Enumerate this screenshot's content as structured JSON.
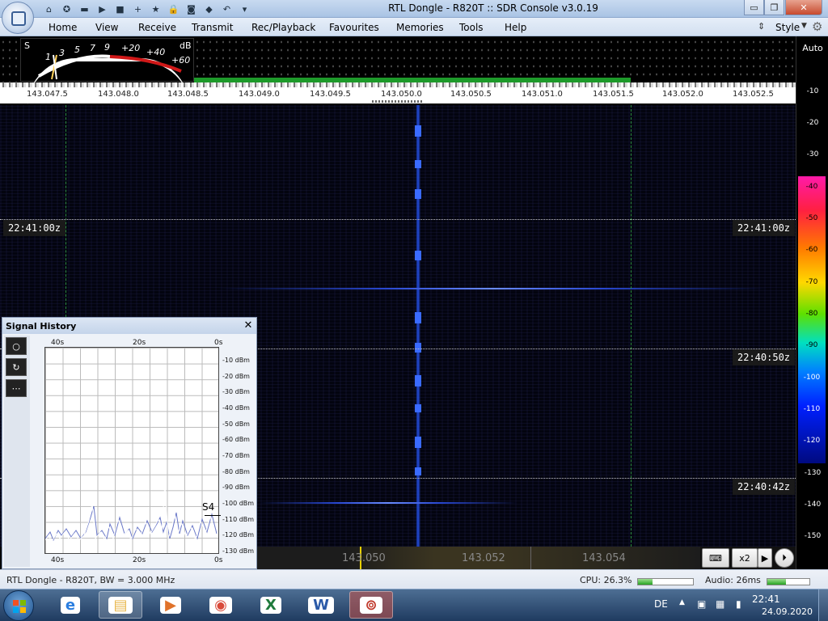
{
  "window": {
    "title": "RTL Dongle - R820T :: SDR Console v3.0.19",
    "min": "▭",
    "max": "❐",
    "close": "✕"
  },
  "quick_access": [
    {
      "icon": "home-icon",
      "glyph": "⌂"
    },
    {
      "icon": "lifebuoy-icon",
      "glyph": "✪"
    },
    {
      "icon": "folder-icon",
      "glyph": "▬"
    },
    {
      "icon": "play-icon",
      "glyph": "▶"
    },
    {
      "icon": "stop-icon",
      "glyph": "■"
    },
    {
      "icon": "add-icon",
      "glyph": "+"
    },
    {
      "icon": "star-icon",
      "glyph": "★"
    },
    {
      "icon": "lock-icon",
      "glyph": "🔒"
    },
    {
      "icon": "camera-icon",
      "glyph": "◙"
    },
    {
      "icon": "drop-icon",
      "glyph": "◆"
    },
    {
      "icon": "undo-icon",
      "glyph": "↶"
    },
    {
      "icon": "dropdown-icon",
      "glyph": "▾"
    }
  ],
  "menu": [
    "Home",
    "View",
    "Receive",
    "Transmit",
    "Rec/Playback",
    "Favourites",
    "Memories",
    "Tools",
    "Help"
  ],
  "style_label": "Style",
  "smeter": {
    "s": "S",
    "db": "dB",
    "labels": [
      "1",
      "3",
      "5",
      "7",
      "9",
      "+20",
      "+40",
      "+60"
    ]
  },
  "freq_labels": [
    "143.047.5",
    "143.048.0",
    "143.048.5",
    "143.049.0",
    "143.049.5",
    "143.050.0",
    "143.050.5",
    "143.051.0",
    "143.051.5",
    "143.052.0",
    "143.052.5"
  ],
  "time_labels": [
    "22:41:00z",
    "22:40:50z",
    "22:40:42z"
  ],
  "scale": {
    "auto": "Auto",
    "top": [
      "-10",
      "-20",
      "-30"
    ],
    "color": [
      "-40",
      "-50",
      "-60",
      "-70",
      "-80",
      "-90",
      "-100",
      "-110",
      "-120"
    ],
    "bottom": [
      "-130",
      "-140",
      "-150"
    ]
  },
  "signal_history": {
    "title": "Signal History",
    "close": "✕",
    "buttons": [
      "○",
      "↻",
      "⋯"
    ],
    "top_ticks": [
      "40s",
      "20s",
      "0s"
    ],
    "bottom_ticks": [
      "40s",
      "20s",
      "0s"
    ],
    "db_ticks": [
      "-10 dBm",
      "-20 dBm",
      "-30 dBm",
      "-40 dBm",
      "-50 dBm",
      "-60 dBm",
      "-70 dBm",
      "-80 dBm",
      "-90 dBm",
      "-100 dBm",
      "-110 dBm",
      "-120 dBm",
      "-130 dBm"
    ],
    "s_label": "S4"
  },
  "tuner": {
    "f1": "143.050",
    "f2": "143.052",
    "f3": "143.054",
    "zoom": "x2",
    "keyboard": "⌨",
    "arrow": "▶",
    "play": "⏵"
  },
  "status": {
    "device": "RTL Dongle - R820T, BW = 3.000 MHz",
    "cpu": "CPU: 26.3%",
    "audio": "Audio: 26ms",
    "cpu_level": 0.26,
    "audio_level": 0.45
  },
  "taskbar": {
    "apps": [
      {
        "icon": "internet-explorer-icon",
        "glyph": "e",
        "color": "#2a7ee0"
      },
      {
        "icon": "file-explorer-icon",
        "glyph": "▤",
        "color": "#e8b64a"
      },
      {
        "icon": "media-player-icon",
        "glyph": "▶",
        "color": "#e0722a"
      },
      {
        "icon": "chrome-icon",
        "glyph": "◉",
        "color": "#d94a3a"
      },
      {
        "icon": "excel-icon",
        "glyph": "X",
        "color": "#1f7a3c"
      },
      {
        "icon": "word-icon",
        "glyph": "W",
        "color": "#2b5aa8"
      },
      {
        "icon": "sdr-console-icon",
        "glyph": "⊚",
        "color": "#c0392b"
      }
    ],
    "lang": "DE",
    "time": "22:41",
    "date": "24.09.2020"
  }
}
